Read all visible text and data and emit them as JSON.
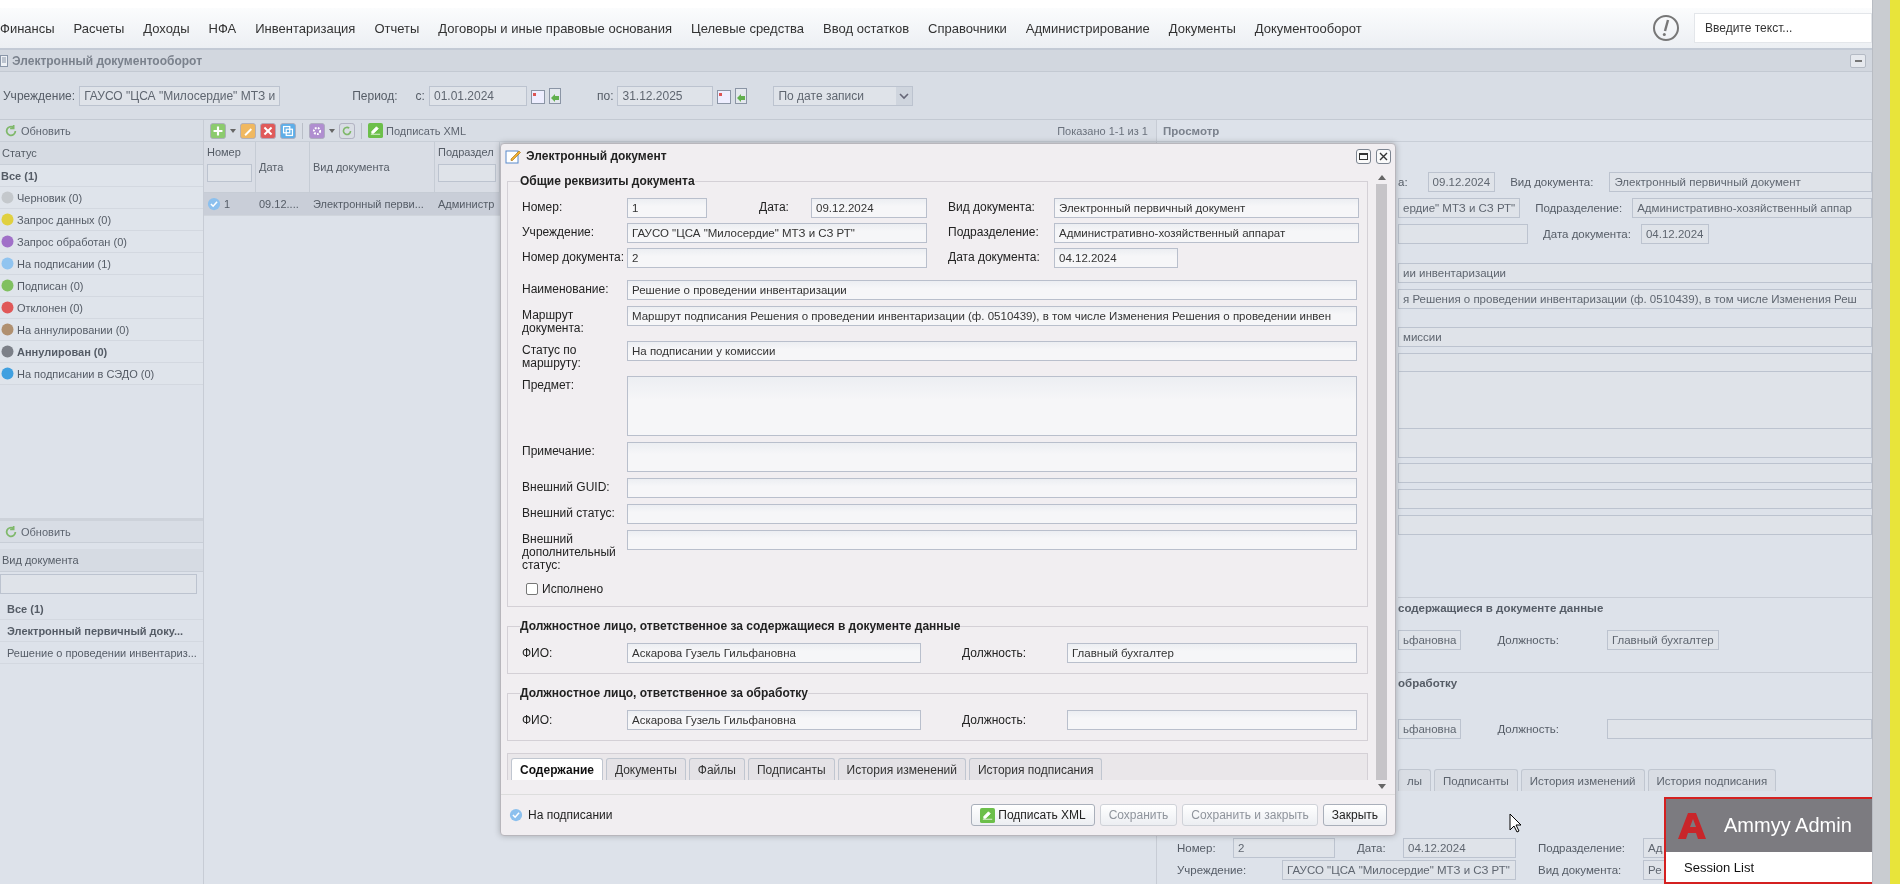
{
  "menu": [
    "Финансы",
    "Расчеты",
    "Доходы",
    "НФА",
    "Инвентаризация",
    "Отчеты",
    "Договоры и иные правовые основания",
    "Целевые средства",
    "Ввод остатков",
    "Справочники",
    "Администрирование",
    "Документы",
    "Документооборот"
  ],
  "search": {
    "placeholder": "Введите текст..."
  },
  "module": {
    "title": "Электронный документооборот"
  },
  "filters": {
    "institution_label": "Учреждение:",
    "institution": "ГАУСО \"ЦСА \"Милосердие\" МТЗ и",
    "period_label": "Период:",
    "from_label": "с:",
    "from": "01.01.2024",
    "to_label": "по:",
    "to": "31.12.2025",
    "date_mode": "По дате записи"
  },
  "status_panel": {
    "refresh": "Обновить",
    "header": "Статус",
    "items": [
      {
        "label": "Все (1)",
        "emphasized": true
      },
      {
        "label": "Черновик (0)",
        "emphasized": false,
        "color": "#c4c8cc"
      },
      {
        "label": "Запрос данных (0)",
        "emphasized": false,
        "color": "#e0d040"
      },
      {
        "label": "Запрос обработан (0)",
        "emphasized": false,
        "color": "#a070c8"
      },
      {
        "label": "На подписании (1)",
        "emphasized": false,
        "color": "#90c4f0"
      },
      {
        "label": "Подписан (0)",
        "emphasized": false,
        "color": "#80c060"
      },
      {
        "label": "Отклонен (0)",
        "emphasized": false,
        "color": "#e05858"
      },
      {
        "label": "На аннулировании (0)",
        "emphasized": false,
        "color": "#b09070"
      },
      {
        "label": "Аннулирован (0)",
        "emphasized": true,
        "color": "#7c8088"
      },
      {
        "label": "На подписании в СЭДО (0)",
        "emphasized": false,
        "color": "#40a0e0"
      }
    ]
  },
  "type_panel": {
    "refresh": "Обновить",
    "header": "Вид документа",
    "items": [
      {
        "label": "Все (1)",
        "emphasized": true
      },
      {
        "label": "Электронный первичный доку...",
        "emphasized": true
      },
      {
        "label": "Решение о проведении инвентариз...",
        "emphasized": false
      }
    ]
  },
  "documents": {
    "sign": "Подписать XML",
    "shown": "Показано 1-1 из 1",
    "columns": [
      "Номер",
      "Дата",
      "Вид документа",
      "Подраздел"
    ],
    "rows": [
      {
        "selected": true,
        "cells": [
          "1",
          "09.12....",
          "Электронный перви...",
          "Администр"
        ]
      }
    ]
  },
  "preview": {
    "title": "Просмотр",
    "date_label": "а:",
    "date": "09.12.2024",
    "doc_type_label": "Вид документа:",
    "doc_type": "Электронный первичный документ",
    "institution": "ердие\" МТЗ и СЗ РТ\"",
    "department_label": "Подразделение:",
    "department": "Административно-хозяйственный аппар",
    "doc_date_label": "Дата документа:",
    "doc_date": "04.12.2024",
    "name": "ии инвентаризации",
    "route": "я Решения о проведении инвентаризации (ф. 0510439), в том числе Изменения Реш",
    "route_status": "миссии",
    "responsible_title": "содержащиеся в документе данные",
    "responsible_name": "ьфановна",
    "responsible_position_label": "Должность:",
    "responsible_position": "Главный бухгалтер",
    "processor_title": "обработку",
    "processor_name": "ьфановна",
    "processor_position_label": "Должность:",
    "tabs": [
      {
        "label": "лы",
        "selected": false
      },
      {
        "label": "Подписанты",
        "selected": false
      },
      {
        "label": "История изменений",
        "selected": false
      },
      {
        "label": "История подписания",
        "selected": false
      }
    ],
    "lower": {
      "number_label": "Номер:",
      "number": "2",
      "date_label": "Дата:",
      "date": "04.12.2024",
      "department_label": "Подразделение:",
      "department": "Ад",
      "institution_label": "Учреждение:",
      "institution": "ГАУСО \"ЦСА \"Милосердие\" МТЗ и СЗ РТ\"",
      "doc_type_label": "Вид документа:",
      "doc_type": "Ре"
    }
  },
  "dialog": {
    "title": "Электронный документ",
    "general": {
      "title": "Общие реквизиты документа",
      "number_label": "Номер:",
      "number": "1",
      "date_label": "Дата:",
      "date": "09.12.2024",
      "doc_type_label": "Вид документа:",
      "doc_type": "Электронный первичный документ",
      "institution_label": "Учреждение:",
      "institution": "ГАУСО \"ЦСА \"Милосердие\" МТЗ и СЗ РТ\"",
      "department_label": "Подразделение:",
      "department": "Административно-хозяйственный аппарат",
      "doc_number_label": "Номер документа:",
      "doc_number": "2",
      "doc_date_label": "Дата документа:",
      "doc_date": "04.12.2024",
      "fields": [
        {
          "label": "Наименование:",
          "value": "Решение о проведении инвентаризации",
          "kind": "line"
        },
        {
          "label": "Маршрут документа:",
          "value": "Маршрут подписания Решения о проведении инвентаризации (ф. 0510439), в том числе Изменения Решения о проведении инвен",
          "kind": "line"
        },
        {
          "label": "Статус по маршруту:",
          "value": "На подписании у комиссии",
          "kind": "line"
        },
        {
          "label": "Предмет:",
          "kind": "area"
        },
        {
          "label": "Примечание:",
          "kind": "tall"
        },
        {
          "label": "Внешний GUID:",
          "kind": "line"
        },
        {
          "label": "Внешний статус:",
          "kind": "line"
        },
        {
          "label": "Внешний дополнительный статус:",
          "kind": "line"
        }
      ],
      "done": {
        "label": "Исполнено",
        "checked": false
      }
    },
    "responsible": {
      "title": "Должностное лицо, ответственное за содержащиеся в документе данные",
      "name_label": "ФИО:",
      "name": "Аскарова Гузель Гильфановна",
      "position_label": "Должность:",
      "position": "Главный бухгалтер"
    },
    "processor": {
      "title": "Должностное лицо, ответственное за обработку",
      "name_label": "ФИО:",
      "name": "Аскарова Гузель Гильфановна",
      "position_label": "Должность:"
    },
    "tabs": [
      {
        "label": "Содержание",
        "selected": true
      },
      {
        "label": "Документы",
        "selected": false
      },
      {
        "label": "Файлы",
        "selected": false
      },
      {
        "label": "Подписанты",
        "selected": false
      },
      {
        "label": "История изменений",
        "selected": false
      },
      {
        "label": "История подписания",
        "selected": false
      }
    ],
    "status": "На подписании",
    "buttons": [
      {
        "label": "Подписать XML",
        "kind": "sign",
        "disabled": false
      },
      {
        "label": "Сохранить",
        "kind": "plain",
        "disabled": true
      },
      {
        "label": "Сохранить и закрыть",
        "kind": "plain",
        "disabled": true
      },
      {
        "label": "Закрыть",
        "kind": "plain",
        "disabled": false
      }
    ]
  },
  "popup": {
    "title": "Ammyy Admin",
    "item": "Session List"
  }
}
